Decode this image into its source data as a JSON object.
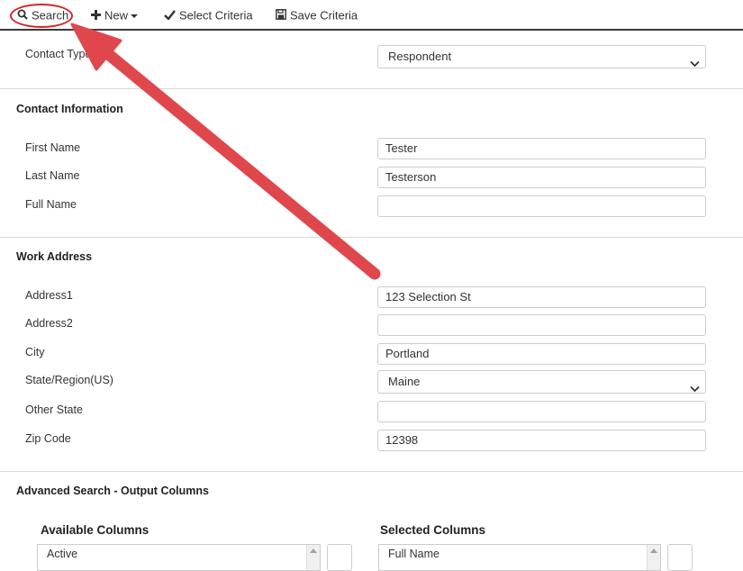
{
  "toolbar": {
    "search_label": "Search",
    "new_label": "New",
    "select_criteria_label": "Select Criteria",
    "save_criteria_label": "Save Criteria"
  },
  "contact_type": {
    "label": "Contact Type",
    "value": "Respondent"
  },
  "contact_information": {
    "title": "Contact Information",
    "first_name": {
      "label": "First Name",
      "value": "Tester"
    },
    "last_name": {
      "label": "Last Name",
      "value": "Testerson"
    },
    "full_name": {
      "label": "Full Name",
      "value": ""
    }
  },
  "work_address": {
    "title": "Work Address",
    "address1": {
      "label": "Address1",
      "value": "123 Selection St"
    },
    "address2": {
      "label": "Address2",
      "value": ""
    },
    "city": {
      "label": "City",
      "value": "Portland"
    },
    "state": {
      "label": "State/Region(US)",
      "value": "Maine"
    },
    "other_state": {
      "label": "Other State",
      "value": ""
    },
    "zip": {
      "label": "Zip Code",
      "value": "12398"
    }
  },
  "advanced_search": {
    "title": "Advanced Search - Output Columns",
    "available_header": "Available Columns",
    "available_first_item": "Active",
    "selected_header": "Selected Columns",
    "selected_first_item": "Full Name"
  },
  "colors": {
    "annotation_red": "#e0474c",
    "circle_red": "#d0262c",
    "toolbar_border": "#3a3a3a"
  }
}
